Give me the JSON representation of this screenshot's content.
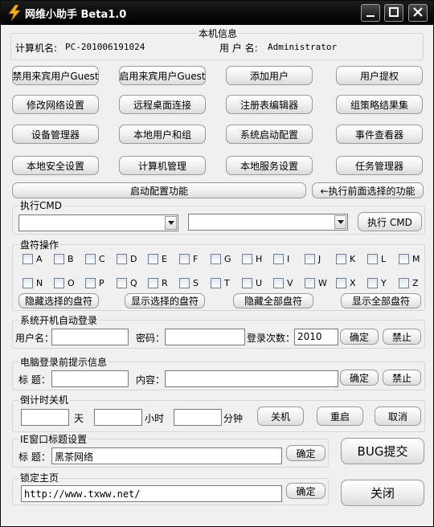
{
  "window": {
    "title": "网维小助手 Beta1.0",
    "minimize_label": "—",
    "close_label": "✕"
  },
  "machine_info": {
    "group_title": "本机信息",
    "computer_name_label": "计算机名:",
    "computer_name_value": "PC-201006191024",
    "user_name_label": "用 户 名:",
    "user_name_value": "Administrator"
  },
  "tools": {
    "disable_guest": "禁用来宾用户Guest",
    "enable_guest": "启用来宾用户Guest",
    "add_user": "添加用户",
    "user_privilege": "用户提权",
    "modify_network": "修改网络设置",
    "remote_desktop": "远程桌面连接",
    "registry_editor": "注册表编辑器",
    "group_policy_result": "组策略结果集",
    "device_manager": "设备管理器",
    "local_users_groups": "本地用户和组",
    "system_startup_config": "系统启动配置",
    "event_viewer": "事件查看器",
    "local_security": "本地安全设置",
    "computer_management": "计算机管理",
    "local_services": "本地服务设置",
    "task_manager": "任务管理器",
    "boot_config_function": "启动配置功能",
    "execute_selected_function": "←执行前面选择的功能"
  },
  "cmd": {
    "group_title": "执行CMD",
    "execute_label": "执行 CMD",
    "combo1_value": "",
    "combo2_value": ""
  },
  "drives": {
    "group_title": "盘符操作",
    "row1": [
      "A",
      "B",
      "C",
      "D",
      "E",
      "F",
      "G",
      "H",
      "I",
      "J",
      "K",
      "L",
      "M"
    ],
    "row2": [
      "N",
      "O",
      "P",
      "Q",
      "R",
      "S",
      "T",
      "U",
      "V",
      "W",
      "X",
      "Y",
      "Z"
    ],
    "hide_selected": "隐藏选择的盘符",
    "show_selected": "显示选择的盘符",
    "hide_all": "隐藏全部盘符",
    "show_all": "显示全部盘符"
  },
  "autologin": {
    "group_title": "系统开机自动登录",
    "user_label": "用户名：",
    "user_value": "",
    "password_label": "密码：",
    "password_value": "",
    "count_label": "登录次数：",
    "count_value": "2010",
    "confirm": "确定",
    "disable": "禁止"
  },
  "prelogin": {
    "group_title": "电脑登录前提示信息",
    "title_label": "标 题：",
    "title_value": "",
    "content_label": "内容：",
    "content_value": "",
    "confirm": "确定",
    "disable": "禁止"
  },
  "shutdown": {
    "group_title": "倒计时关机",
    "days_value": "",
    "days_unit": "天",
    "hours_value": "",
    "hours_unit": "小时",
    "minutes_value": "",
    "minutes_unit": "分钟",
    "shutdown": "关机",
    "restart": "重启",
    "cancel": "取消"
  },
  "ie_title": {
    "group_title": "IE窗口标题设置",
    "title_label": "标 题：",
    "title_value": "黑茶网络",
    "confirm": "确定"
  },
  "homepage": {
    "group_title": "锁定主页",
    "url_value": "http://www.txww.net/",
    "confirm": "确定"
  },
  "bug_submit": "BUG提交",
  "close": "关闭"
}
